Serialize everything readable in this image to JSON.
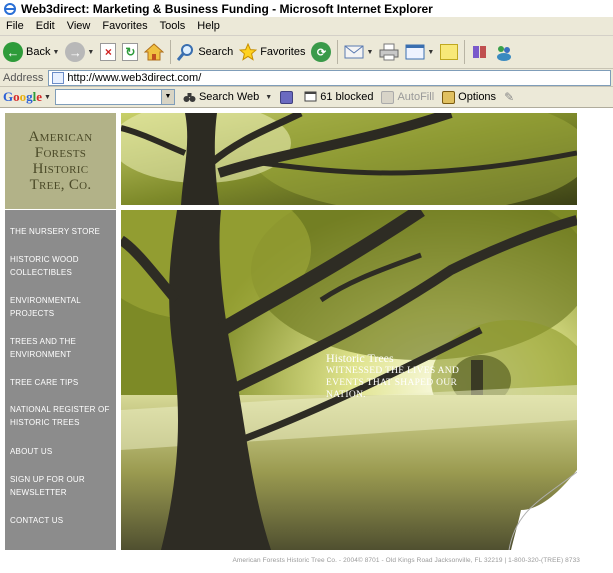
{
  "window": {
    "title": "Web3direct: Marketing & Business Funding - Microsoft Internet Explorer"
  },
  "menu": [
    "File",
    "Edit",
    "View",
    "Favorites",
    "Tools",
    "Help"
  ],
  "toolbar": {
    "back_label": "Back",
    "search_label": "Search",
    "favorites_label": "Favorites"
  },
  "address": {
    "label": "Address",
    "url": "http://www.web3direct.com/"
  },
  "google_toolbar": {
    "logo": "Google",
    "search_web_label": "Search Web",
    "blocked_label": "61 blocked",
    "autofill_label": "AutoFill",
    "options_label": "Options"
  },
  "site": {
    "logo_lines": [
      "American",
      "Forests",
      "Historic",
      "Tree, Co."
    ],
    "nav": [
      "The Nursery Store",
      "Historic Wood Collectibles",
      "Environmental Projects",
      "Trees and the Environment",
      "Tree Care Tips",
      "National Register of Historic Trees",
      "About Us",
      "Sign Up for our Newsletter",
      "Contact Us"
    ],
    "caption_heading": "Historic Trees",
    "caption_body": "witnessed the lives and events that shaped our nation.",
    "footer": "American Forests Historic Tree Co. - 2004© 8701 - Old Kings Road Jacksonville, FL 32219 | 1-800-320-(TREE) 8733"
  },
  "colors": {
    "chrome": "#ece9d8",
    "logo_bg": "#b2b288",
    "logo_text": "#4b4a28",
    "nav_bg": "#8c8c8c"
  }
}
